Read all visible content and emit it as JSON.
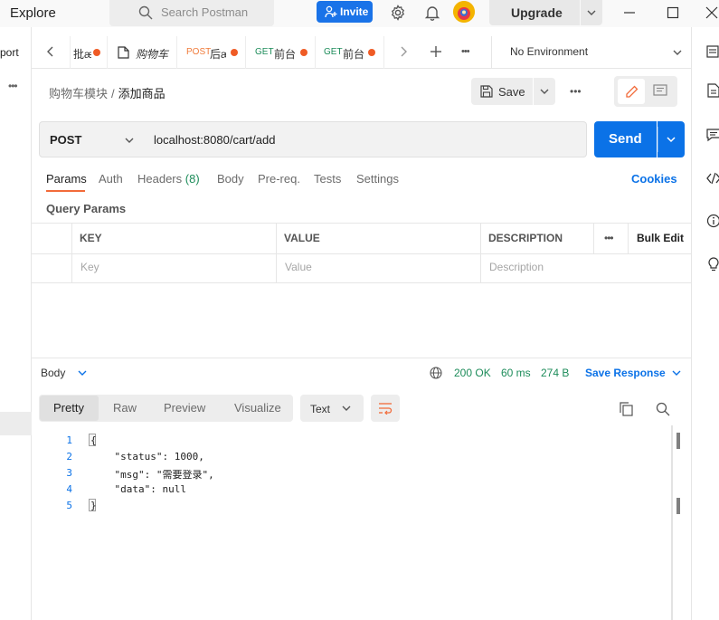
{
  "topbar": {
    "explore_label": "Explore",
    "search_placeholder": "Search Postman",
    "invite_label": "Invite",
    "upgrade_label": "Upgrade"
  },
  "sidebar": {
    "import_label": "port",
    "more_label": "•••"
  },
  "tabs": [
    {
      "method": "",
      "name": "批æ",
      "unsaved": true
    },
    {
      "method": "",
      "name": "购物车",
      "unsaved": false,
      "italic": true
    },
    {
      "method": "POST",
      "name": "后æ",
      "unsaved": true,
      "method_color": "#f07b3a"
    },
    {
      "method": "GET",
      "name": "前台",
      "unsaved": true,
      "method_color": "#1d8c5a"
    },
    {
      "method": "GET",
      "name": "前台",
      "unsaved": true,
      "method_color": "#1d8c5a"
    }
  ],
  "environment": {
    "selected": "No Environment"
  },
  "breadcrumb": {
    "collection": "购物车模块",
    "separator": "/",
    "request": "添加商品"
  },
  "save_label": "Save",
  "request": {
    "method": "POST",
    "url": "localhost:8080/cart/add",
    "send_label": "Send"
  },
  "request_tabs": {
    "params": "Params",
    "auth": "Auth",
    "headers": "Headers",
    "headers_count": "(8)",
    "body": "Body",
    "prereq": "Pre-req.",
    "tests": "Tests",
    "settings": "Settings",
    "cookies": "Cookies"
  },
  "query_params": {
    "title": "Query Params",
    "columns": {
      "key": "KEY",
      "value": "VALUE",
      "description": "DESCRIPTION",
      "bulk_edit": "Bulk Edit"
    },
    "placeholders": {
      "key": "Key",
      "value": "Value",
      "description": "Description"
    }
  },
  "response": {
    "body_label": "Body",
    "status": "200 OK",
    "time": "60 ms",
    "size": "274 B",
    "save_response": "Save Response",
    "view_tabs": [
      "Pretty",
      "Raw",
      "Preview",
      "Visualize"
    ],
    "format": "Text",
    "lines": [
      {
        "n": "1",
        "text": "{"
      },
      {
        "n": "2",
        "text": "    \"status\": 1000,"
      },
      {
        "n": "3",
        "text": "    \"msg\": \"需要登录\","
      },
      {
        "n": "4",
        "text": "    \"data\": null"
      },
      {
        "n": "5",
        "text": "}"
      }
    ]
  },
  "colors": {
    "accent_orange": "#f26b3a",
    "brand_blue": "#0b72e7",
    "status_green": "#1d8c5a",
    "unsaved_dot": "#ef5b25"
  }
}
